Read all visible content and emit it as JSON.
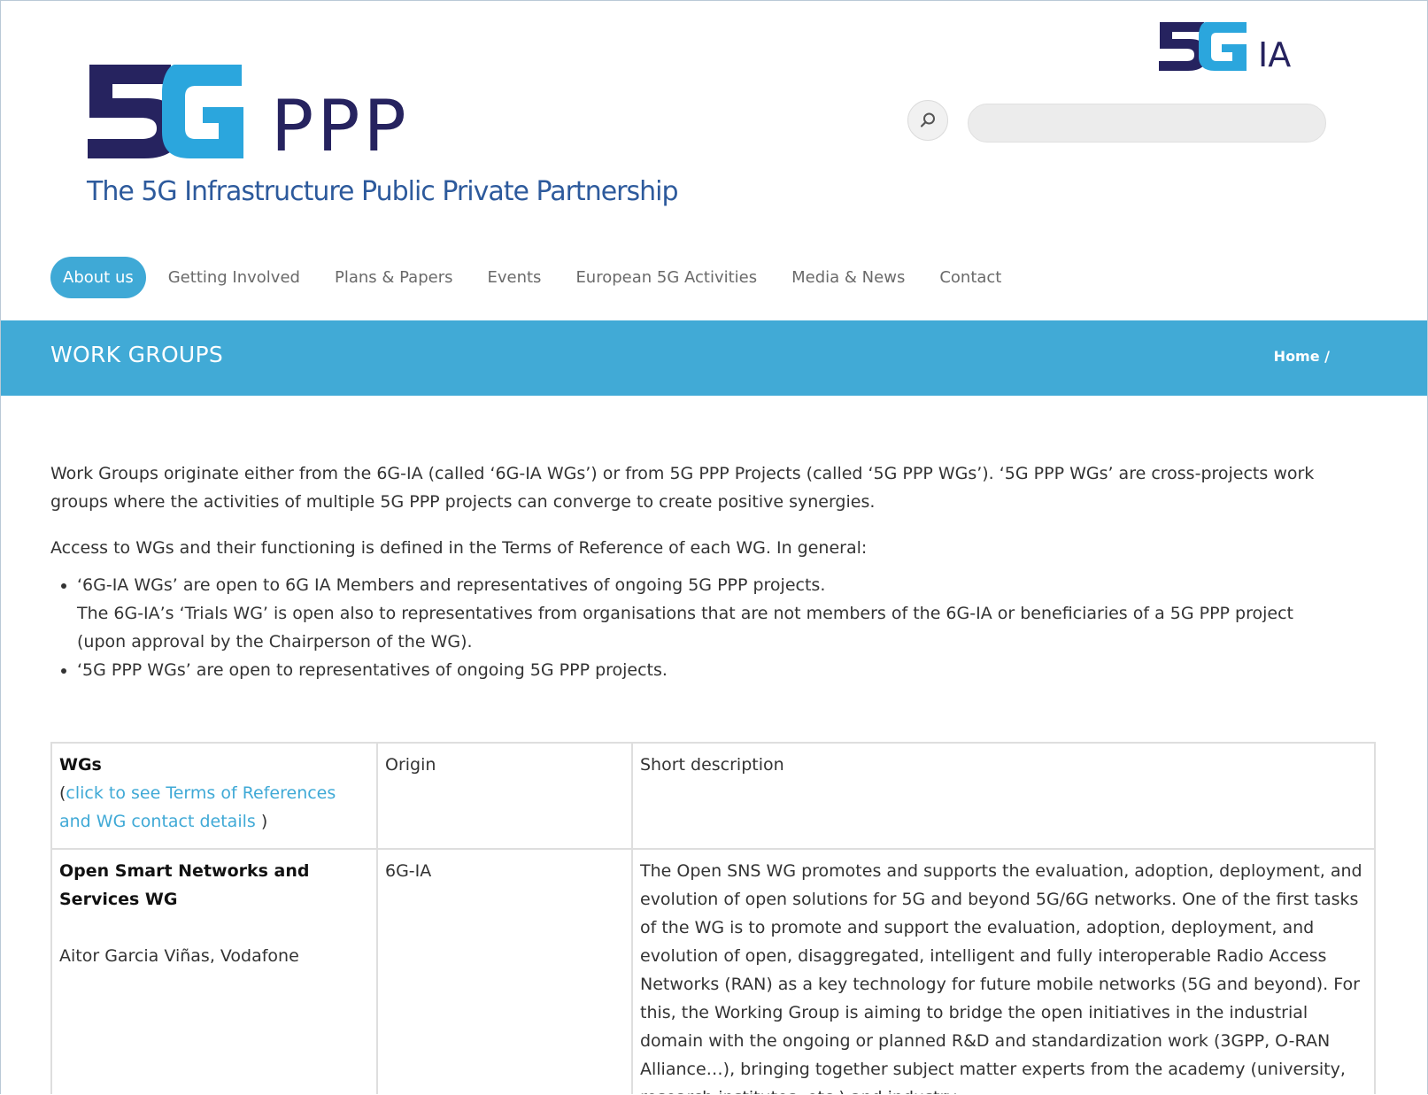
{
  "header": {
    "logo_ppp": "PPP",
    "tagline": "The 5G Infrastructure Public Private Partnership",
    "brand_ia": "IA",
    "colors": {
      "navy": "#26235f",
      "cyan": "#2ba6dd",
      "nav_active": "#3fa9d6"
    }
  },
  "search": {
    "icon": "search-icon",
    "placeholder": "",
    "value": ""
  },
  "nav": {
    "items": [
      {
        "label": "About us",
        "active": true
      },
      {
        "label": "Getting Involved"
      },
      {
        "label": "Plans & Papers"
      },
      {
        "label": "Events"
      },
      {
        "label": "European 5G Activities"
      },
      {
        "label": "Media & News"
      },
      {
        "label": "Contact"
      }
    ]
  },
  "titlebar": {
    "title": "WORK GROUPS",
    "breadcrumb": "Home /"
  },
  "content": {
    "intro": "Work Groups originate either from the 6G-IA (called ‘6G-IA WGs’) or from 5G PPP Projects (called ‘5G PPP WGs’).  ‘5G PPP WGs’ are cross-projects work groups where the activities of multiple 5G PPP projects can converge to create positive synergies.",
    "access": "Access to WGs and their functioning is defined in the Terms of Reference of each WG. In general:",
    "bullet1_line1": "‘6G-IA WGs’ are open to 6G IA Members and representatives of ongoing 5G PPP projects.",
    "bullet1_line2": "The 6G-IA’s ‘Trials WG’ is open also to representatives from organisations that are not members of the 6G-IA or beneficiaries of a 5G PPP project (upon approval by the Chairperson of the WG).",
    "bullet2": "‘5G PPP WGs’ are open to representatives of ongoing 5G PPP projects."
  },
  "table": {
    "header": {
      "col1_title": "WGs",
      "col1_paren_open": "(",
      "col1_link": "click to see Terms of References and WG contact details",
      "col1_paren_close": " )",
      "col2": "Origin",
      "col3": "Short description"
    },
    "rows": [
      {
        "name": "Open Smart Networks and Services WG",
        "chair": "Aitor Garcia Viñas, Vodafone",
        "origin": "6G-IA",
        "description": "The Open SNS WG promotes and supports the evaluation, adoption, deployment, and evolution of open solutions for 5G and beyond 5G/6G networks. One of the first tasks of the WG is to promote and support the evaluation, adoption, deployment, and evolution of open, disaggregated, intelligent and fully interoperable Radio Access Networks (RAN) as a key technology for future mobile networks (5G and beyond). For this, the Working Group is aiming to bridge the open initiatives in the industrial domain with the ongoing or planned R&D and standardization work (3GPP, O-RAN Alliance…), bringing together subject matter experts from the academy (university, research institutes, etc.) and industry"
      }
    ]
  }
}
